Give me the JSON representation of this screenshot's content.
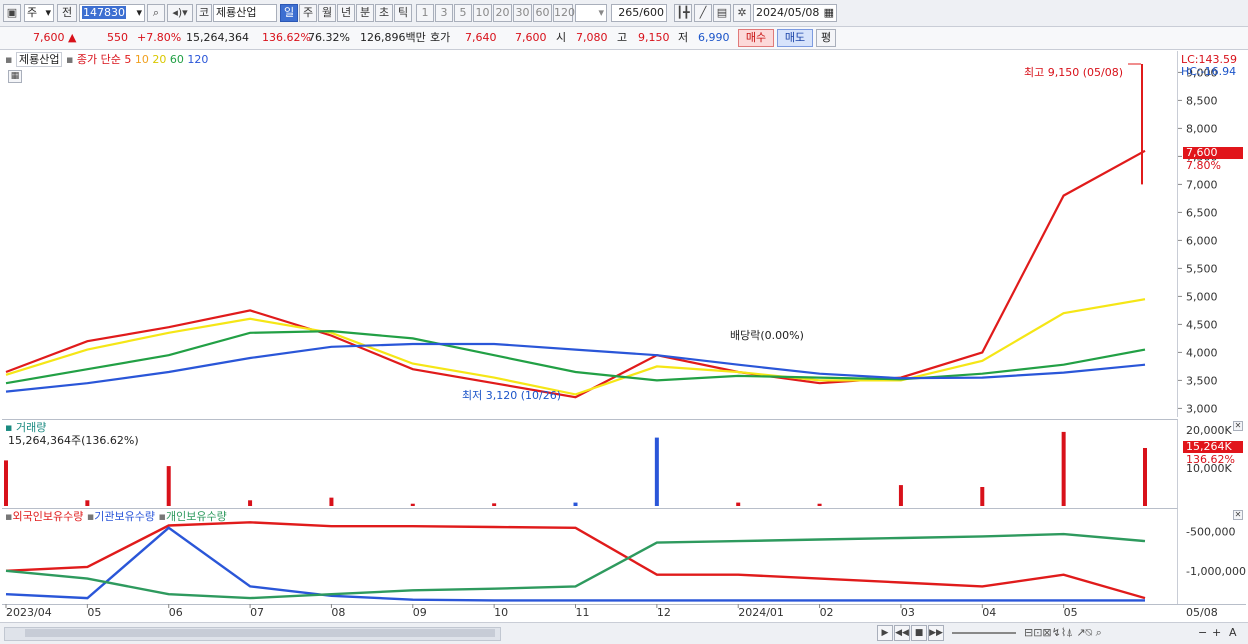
{
  "toolbar": {
    "market_type": "주",
    "prev_label": "전",
    "code": "147830",
    "market_badge": "코",
    "stock_name": "제룡산업",
    "periods": [
      "일",
      "주",
      "월",
      "년",
      "분",
      "초",
      "틱"
    ],
    "active_period": "일",
    "intervals": [
      "1",
      "3",
      "5",
      "10",
      "20",
      "30",
      "60",
      "120"
    ],
    "count_display": "265/600",
    "date": "2024/05/08"
  },
  "quote": {
    "price": "7,600",
    "arrow": "▲",
    "change": "550",
    "change_pct": "+7.80%",
    "volume": "15,264,364",
    "volume_ratio": "136.62%",
    "turnover": "76.32%",
    "amount": "126,896백만",
    "ask_label": "호가",
    "ask": "7,640",
    "bid": "7,600",
    "open_label": "시",
    "open": "7,080",
    "high_label": "고",
    "high": "9,150",
    "low_label": "저",
    "low": "6,990",
    "buy_label": "매수",
    "sell_label": "매도",
    "eval_label": "평"
  },
  "price_panel": {
    "legend_name": "제룡산업",
    "legend_ma_prefix": "종가 단순",
    "ma_periods": [
      "5",
      "10",
      "20",
      "60",
      "120"
    ],
    "ma_colors": [
      "#e01b1b",
      "#f0a020",
      "#f5e616",
      "#22a045",
      "#2a56d8"
    ],
    "lc": "LC:143.59",
    "hc": "HC:-16.94",
    "high_annotation": "최고 9,150 (05/08)",
    "low_annotation": "최저 3,120 (10/26)",
    "dividend_annotation": "배당락(0.00%)",
    "current_tag": "7,600",
    "current_pct": "7.80%"
  },
  "volume_panel": {
    "title": "거래량",
    "info": "15,264,364주(136.62%)",
    "current_tag": "15,264K",
    "current_pct": "136.62%"
  },
  "holdings_panel": {
    "legend": [
      "외국인보유수량",
      "기관보유수량",
      "개인보유수량"
    ],
    "colors": [
      "#e01b1b",
      "#2a56d8",
      "#2e9a5e"
    ]
  },
  "x_axis": [
    "2023/04",
    "05",
    "06",
    "07",
    "08",
    "09",
    "10",
    "11",
    "12",
    "2024/01",
    "02",
    "03",
    "04",
    "05",
    "05/08"
  ],
  "chart_data": [
    {
      "type": "line",
      "title": "제룡산업",
      "y_axis_ticks": [
        "9,000",
        "8,500",
        "8,000",
        "7,500",
        "7,000",
        "6,500",
        "6,000",
        "5,500",
        "5,000",
        "4,500",
        "4,000",
        "3,500",
        "3,000"
      ],
      "ylim": [
        2900,
        9150
      ],
      "x": [
        "2023/04",
        "05",
        "06",
        "07",
        "08",
        "09",
        "10",
        "11",
        "12",
        "2024/01",
        "02",
        "03",
        "04",
        "05",
        "05/08"
      ],
      "series": [
        {
          "name": "5",
          "values": [
            3650,
            4200,
            4450,
            4750,
            4300,
            3700,
            3450,
            3200,
            3950,
            3650,
            3450,
            3550,
            4000,
            6800,
            7600
          ]
        },
        {
          "name": "20",
          "values": [
            3600,
            4050,
            4350,
            4600,
            4350,
            3800,
            3550,
            3250,
            3750,
            3650,
            3500,
            3500,
            3850,
            4700,
            4950
          ]
        },
        {
          "name": "60",
          "values": [
            3450,
            3700,
            3950,
            4350,
            4380,
            4250,
            3950,
            3650,
            3500,
            3580,
            3550,
            3520,
            3620,
            3780,
            4050
          ]
        },
        {
          "name": "120",
          "values": [
            3300,
            3450,
            3650,
            3900,
            4100,
            4150,
            4150,
            4050,
            3950,
            3780,
            3620,
            3540,
            3550,
            3640,
            3780
          ]
        }
      ]
    },
    {
      "type": "bar",
      "title": "거래량",
      "y_axis_ticks": [
        "20,000K",
        "10,000K"
      ],
      "ylim": [
        0,
        20000
      ],
      "x": [
        "2023/04",
        "05",
        "06",
        "07",
        "08",
        "09",
        "10",
        "11",
        "12",
        "2024/01",
        "02",
        "03",
        "04",
        "05",
        "05/08"
      ],
      "values": [
        12000,
        1500,
        10500,
        1500,
        2200,
        600,
        700,
        900,
        18000,
        900,
        600,
        5500,
        5000,
        19500,
        15264
      ]
    },
    {
      "type": "line",
      "title": "외국인보유수량 / 기관보유수량 / 개인보유수량",
      "y_axis_ticks": [
        "-500,000",
        "-1,000,000"
      ],
      "x": [
        "2023/04",
        "05",
        "06",
        "07",
        "08",
        "09",
        "10",
        "11",
        "12",
        "2024/01",
        "02",
        "03",
        "04",
        "05",
        "05/08"
      ],
      "series": [
        {
          "name": "외국인보유수량",
          "values": [
            -1000000,
            -950000,
            -420000,
            -380000,
            -430000,
            -430000,
            -440000,
            -450000,
            -1050000,
            -1050000,
            -1100000,
            -1150000,
            -1200000,
            -1050000,
            -1350000
          ]
        },
        {
          "name": "기관보유수량",
          "values": [
            -1300000,
            -1350000,
            -450000,
            -1200000,
            -1320000,
            -1370000,
            -1380000,
            -1380000,
            -1380000,
            -1380000,
            -1380000,
            -1380000,
            -1380000,
            -1380000,
            -1380000
          ]
        },
        {
          "name": "개인보유수량",
          "values": [
            -1000000,
            -1100000,
            -1300000,
            -1350000,
            -1300000,
            -1250000,
            -1230000,
            -1200000,
            -640000,
            -620000,
            -600000,
            -580000,
            -560000,
            -530000,
            -620000
          ]
        }
      ]
    }
  ]
}
